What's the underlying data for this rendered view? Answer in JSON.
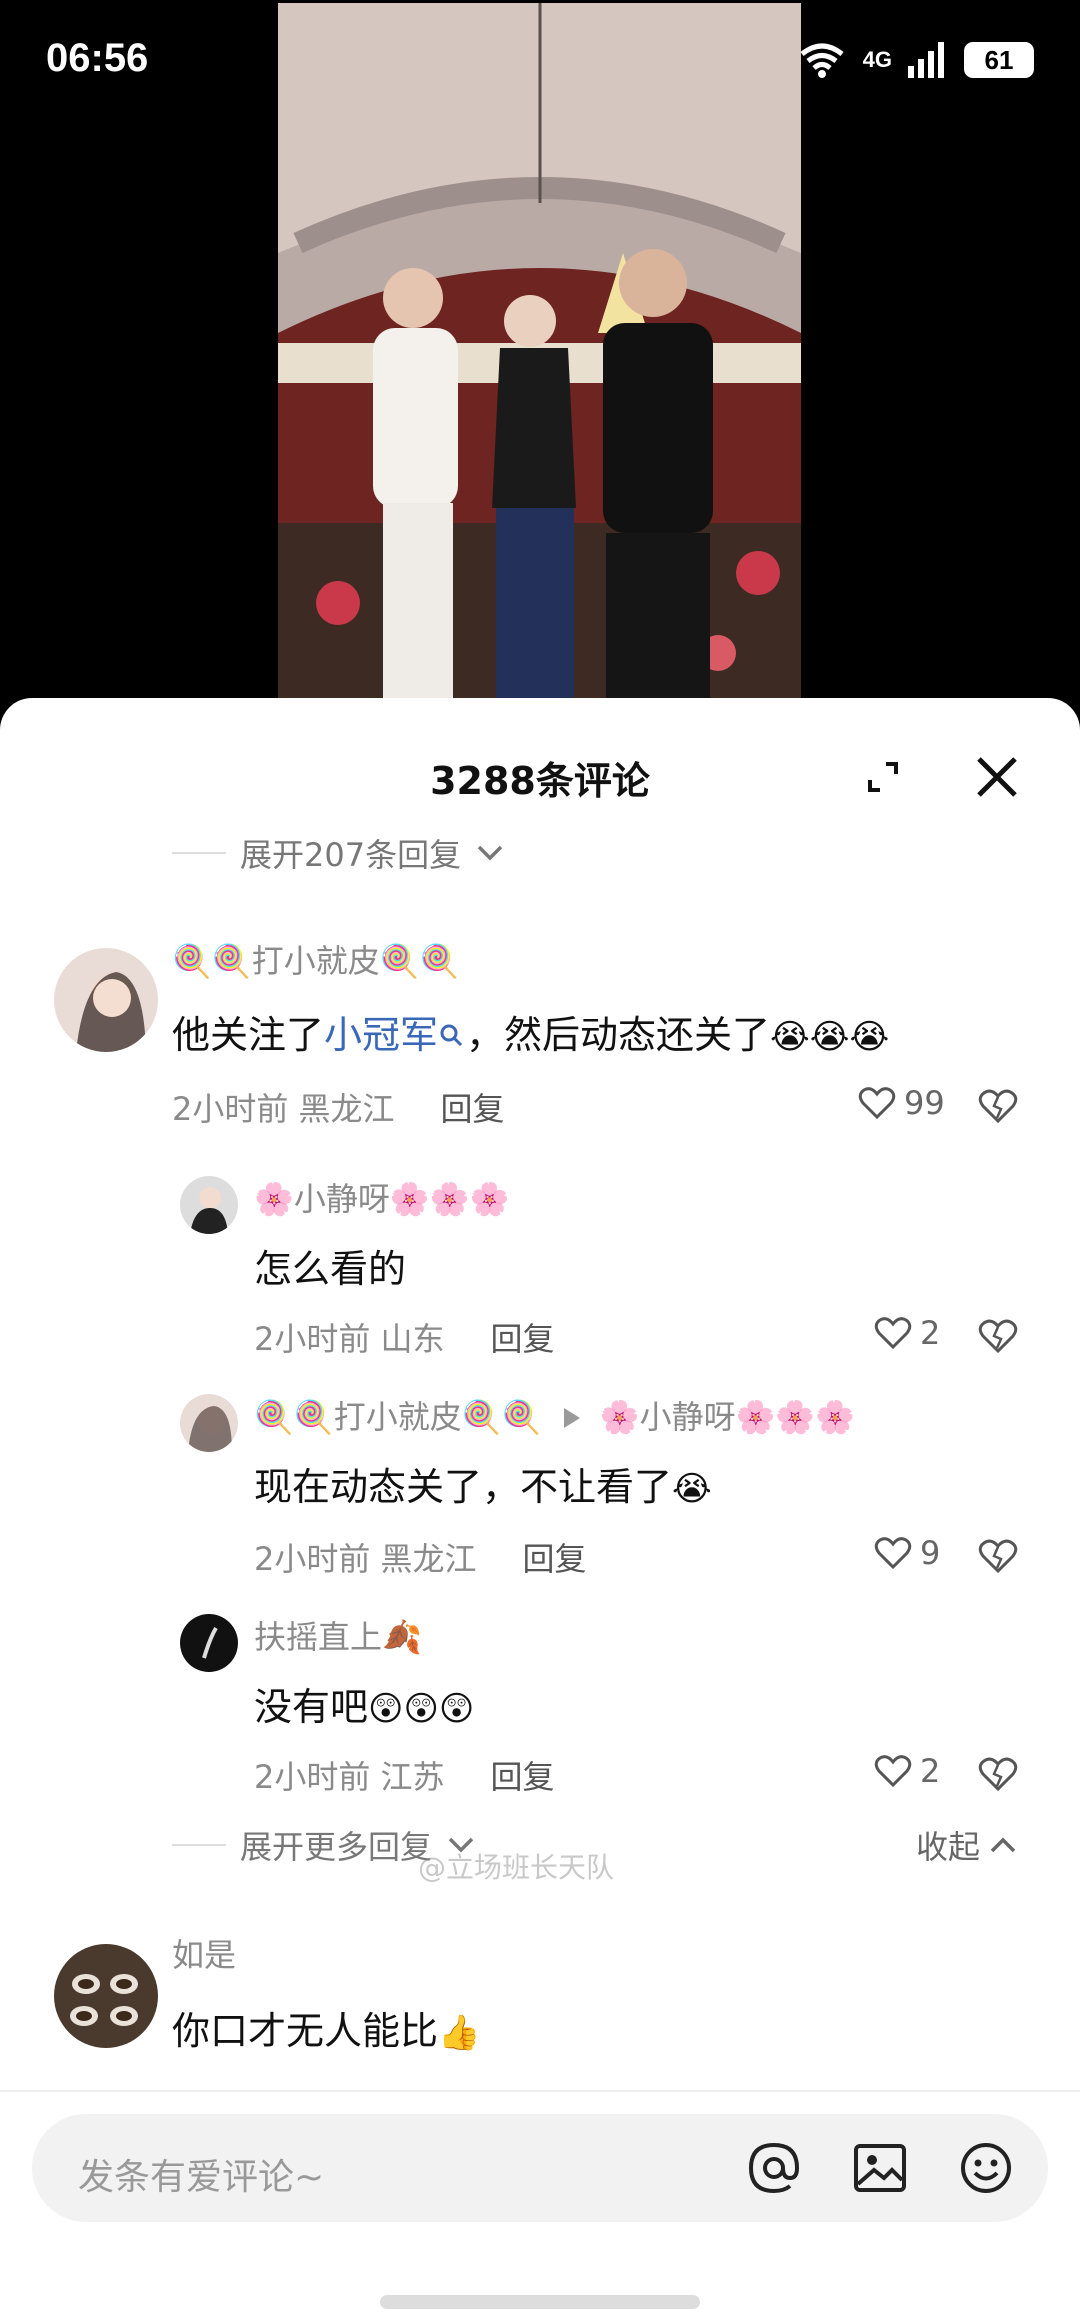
{
  "status_bar": {
    "time": "06:56",
    "network": "4G",
    "battery": "61"
  },
  "comments_panel": {
    "title": "3288条评论",
    "expand_replies_label": "展开207条回复",
    "watermark": "@立场班长天队"
  },
  "comments": {
    "c1": {
      "username": "🍭🍭打小就皮🍭🍭",
      "text_before": "他关注了",
      "link": "小冠军",
      "text_after": "，然后动态还关了",
      "emojis": "😭😭😭",
      "time_location": "2小时前 黑龙江",
      "reply_label": "回复",
      "likes": "99"
    },
    "r1": {
      "username": "🌸小静呀🌸🌸🌸",
      "text": "怎么看的",
      "time_location": "2小时前 山东",
      "reply_label": "回复",
      "likes": "2"
    },
    "r2": {
      "username": "🍭🍭打小就皮🍭🍭",
      "reply_to": "🌸小静呀🌸🌸🌸",
      "text": "现在动态关了，不让看了",
      "emojis": "😭",
      "time_location": "2小时前 黑龙江",
      "reply_label": "回复",
      "likes": "9"
    },
    "r3": {
      "username": "扶摇直上🍂",
      "text": "没有吧",
      "emojis": "😲😲😲",
      "time_location": "2小时前 江苏",
      "reply_label": "回复",
      "likes": "2"
    },
    "more_replies_label": "展开更多回复",
    "collapse_label": "收起",
    "c2": {
      "username": "如是",
      "text": "你口才无人能比",
      "emojis": "👍"
    }
  },
  "input": {
    "placeholder": "发条有爱评论~"
  },
  "icons": [
    "wifi-icon",
    "signal-icon",
    "expand-icon",
    "close-icon",
    "chevron-down-icon",
    "heart-icon",
    "dislike-heart-icon",
    "search-icon",
    "play-triangle-icon",
    "at-icon",
    "image-icon",
    "emoji-icon",
    "chevron-up-icon"
  ]
}
